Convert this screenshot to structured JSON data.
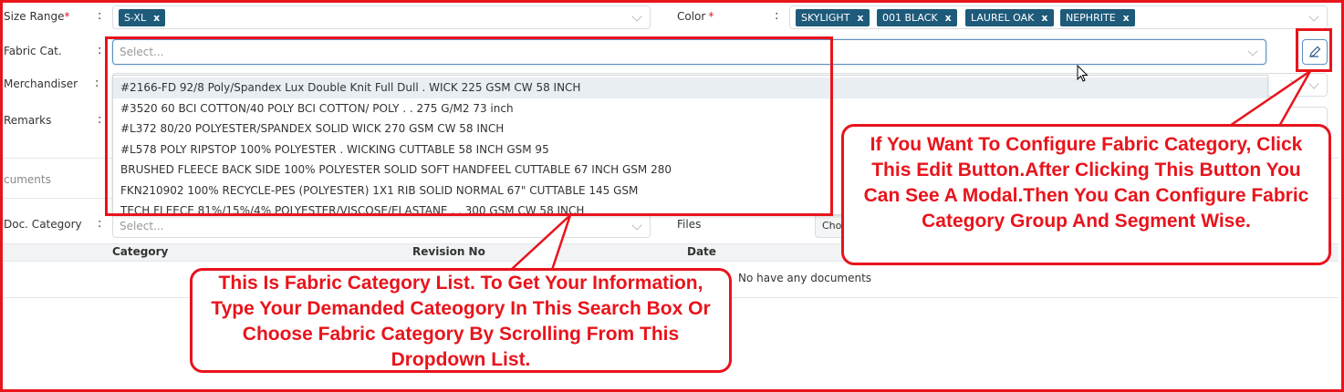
{
  "form": {
    "size_range": {
      "label": "Size Range",
      "required_mark": "*",
      "tags": [
        "S-XL"
      ]
    },
    "color": {
      "label": "Color",
      "required_mark": "*",
      "tags": [
        "SKYLIGHT",
        "001 BLACK",
        "LAUREL OAK",
        "NEPHRITE"
      ]
    },
    "fabric_cat": {
      "label": "Fabric Cat.",
      "placeholder": "Select..."
    },
    "merchandiser": {
      "label": "Merchandiser"
    },
    "remarks": {
      "label": "Remarks"
    },
    "colon": ":",
    "tag_remove": "x"
  },
  "fabric_options": [
    "#2166-FD 92/8 Poly/Spandex Lux Double Knit Full Dull . WICK 225 GSM CW 58 INCH",
    "#3520 60 BCI COTTON/40 POLY BCI COTTON/ POLY . . 275 G/M2 73 inch",
    "#L372 80/20 POLYESTER/SPANDEX SOLID WICK 270 GSM CW 58 INCH",
    "#L578 POLY RIPSTOP 100% POLYESTER . WICKING CUTTABLE 58 INCH GSM 95",
    "BRUSHED FLEECE BACK SIDE 100% POLYESTER SOLID SOFT HANDFEEL CUTTABLE 67 INCH GSM 280",
    "FKN210902 100% RECYCLE-PES (POLYESTER) 1X1 RIB SOLID NORMAL 67\" CUTTABLE 145 GSM",
    "TECH FLEECE 81%/15%/4% POLYESTER/VISCOSE/ELASTANE . . 300 GSM CW 58 INCH"
  ],
  "documents": {
    "section_title": "cuments",
    "doc_category": {
      "label": "Doc. Category",
      "placeholder": "Select..."
    },
    "files": {
      "label": "Files",
      "button": "Cho"
    },
    "table_headers": [
      "Category",
      "Revision No",
      "Date"
    ],
    "empty_message": "No have any documents"
  },
  "callouts": {
    "edit": "If You Want To Configure Fabric Category, Click This Edit Button.After Clicking This Button You Can See A Modal.Then You Can Configure Fabric Category Group And Segment Wise.",
    "list": "This Is Fabric Category List. To Get Your Information, Type Your Demanded Cateogory In This Search Box Or Choose Fabric Category By Scrolling From This Dropdown List."
  },
  "colors": {
    "annotation_red": "#e8141c",
    "tag_bg": "#1e5a7a"
  },
  "icons": {
    "edit": "pencil-icon",
    "clear": "close-icon",
    "dropdown": "chevron-down-icon"
  }
}
